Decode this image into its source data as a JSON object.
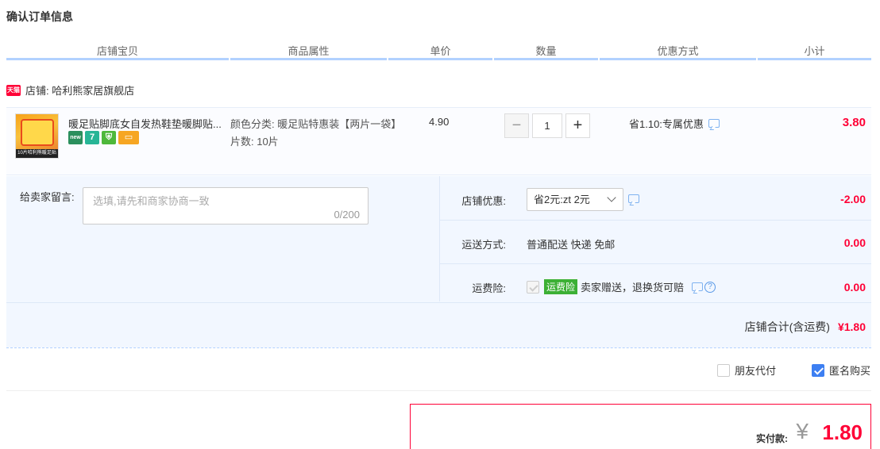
{
  "page_title": "确认订单信息",
  "columns": [
    "店铺宝贝",
    "商品属性",
    "单价",
    "数量",
    "优惠方式",
    "小计"
  ],
  "shop": {
    "icon": "tmall-icon",
    "icon_text": "天猫",
    "name": "店铺: 哈利熊家居旗舰店"
  },
  "item": {
    "title": "暖足贴脚底女自发热鞋垫暖脚贴...",
    "thumb_caption": "10片哈利熊暖足贴",
    "badges": [
      "new",
      "7",
      "",
      ""
    ],
    "attr_color": "颜色分类: 暖足贴特惠装【两片一袋】",
    "attr_count": "片数: 10片",
    "price": "4.90",
    "quantity": "1",
    "minus": "−",
    "plus": "+",
    "discount": "省1.10:专属优惠",
    "subtotal": "3.80"
  },
  "message": {
    "label": "给卖家留言:",
    "placeholder": "选填,请先和商家协商一致",
    "count": "0/200"
  },
  "shop_discount": {
    "label": "店铺优惠:",
    "selected": "省2元:zt 2元",
    "amount": "-2.00"
  },
  "shipping": {
    "label": "运送方式:",
    "value": "普通配送 快递 免邮",
    "amount": "0.00"
  },
  "insurance": {
    "label": "运费险:",
    "tag": "运费险",
    "desc": "卖家赠送，退换货可赔",
    "help": "?",
    "amount": "0.00"
  },
  "shop_total": {
    "label": "店铺合计(含运费)",
    "amount": "¥1.80"
  },
  "options": {
    "friend_pay": "朋友代付",
    "anonymous": "匿名购买",
    "anonymous_checked": true
  },
  "payment": {
    "label": "实付款:",
    "currency": "¥",
    "amount": "1.80"
  },
  "colors": {
    "accent": "#ff0036",
    "header_line": "#b2d1ff",
    "checkbox": "#3d7ff2"
  }
}
